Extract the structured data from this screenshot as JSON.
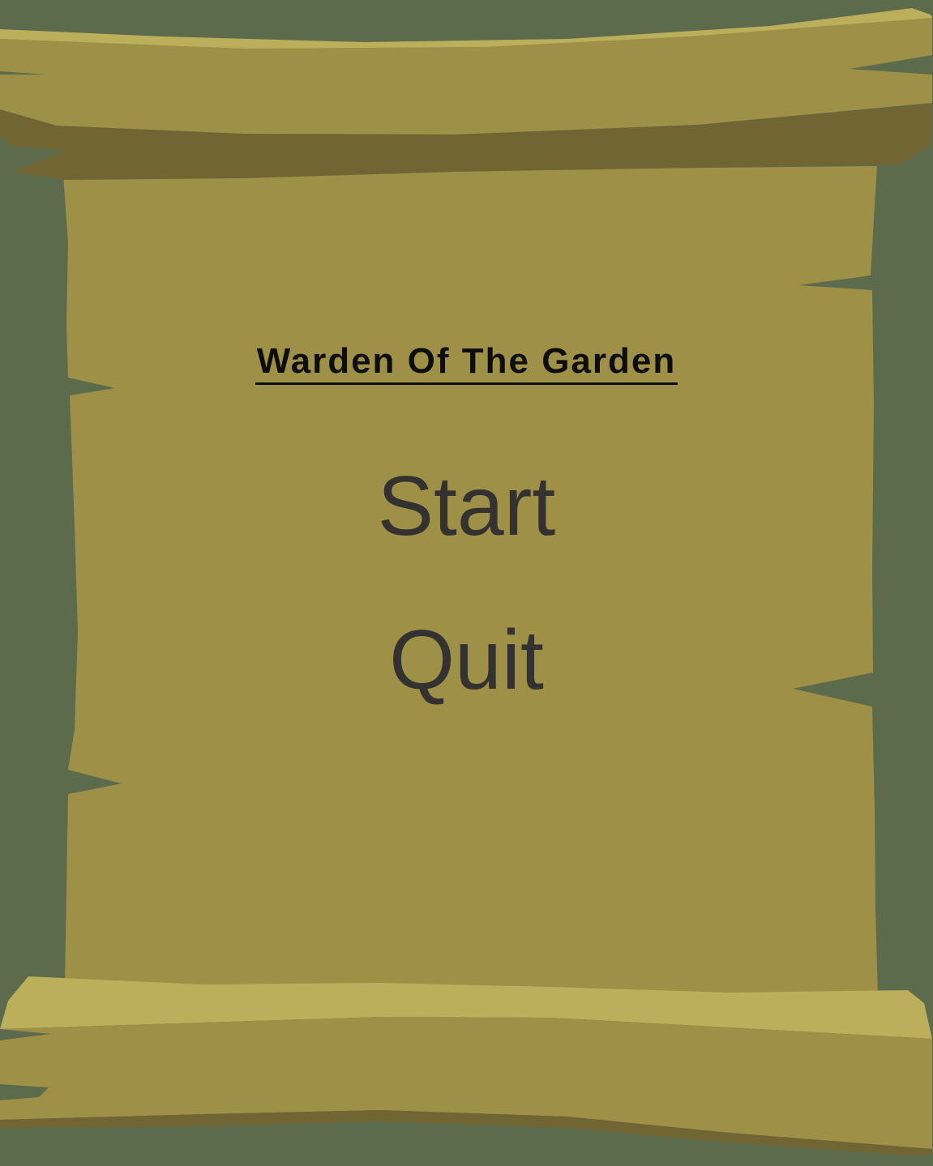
{
  "game": {
    "title": "Warden Of The Garden"
  },
  "menu": {
    "start_label": "Start",
    "quit_label": "Quit"
  },
  "colors": {
    "background": "#5d6b4d",
    "parchment": "#9e9047",
    "roll_highlight": "#bcaf5b",
    "roll_shadow": "#716633",
    "text_dark": "#333231",
    "title_text": "#0d0d0a"
  },
  "icons": [
    "parchment-scroll-graphic"
  ]
}
